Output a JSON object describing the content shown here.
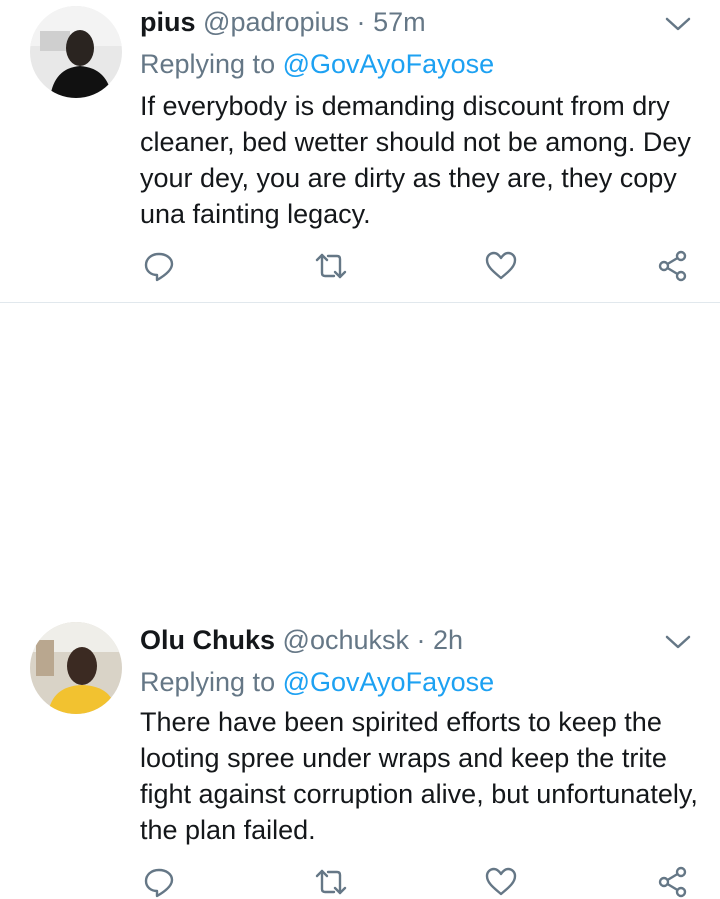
{
  "tweets": [
    {
      "name": "pius",
      "handle": "@padropius",
      "separator": "·",
      "time": "57m",
      "reply_prefix": "Replying to",
      "reply_mention": "@GovAyoFayose",
      "text": "If everybody is demanding discount from dry cleaner, bed wetter should not be among. Dey your dey, you are dirty as they are, they copy una fainting legacy."
    },
    {
      "name": "Olu Chuks",
      "handle": "@ochuksk",
      "separator": "·",
      "time": "2h",
      "reply_prefix": "Replying to",
      "reply_mention": "@GovAyoFayose",
      "text": "There have been spirited efforts to keep the looting spree under wraps  and keep the trite fight against corruption alive, but unfortunately, the plan failed."
    }
  ],
  "icons": {
    "reply": "reply-icon",
    "retweet": "retweet-icon",
    "like": "heart-icon",
    "share": "share-icon",
    "menu": "chevron-down-icon"
  },
  "colors": {
    "text": "#14171a",
    "muted": "#657786",
    "link": "#1da1f2",
    "divider": "#e1e8ed"
  }
}
